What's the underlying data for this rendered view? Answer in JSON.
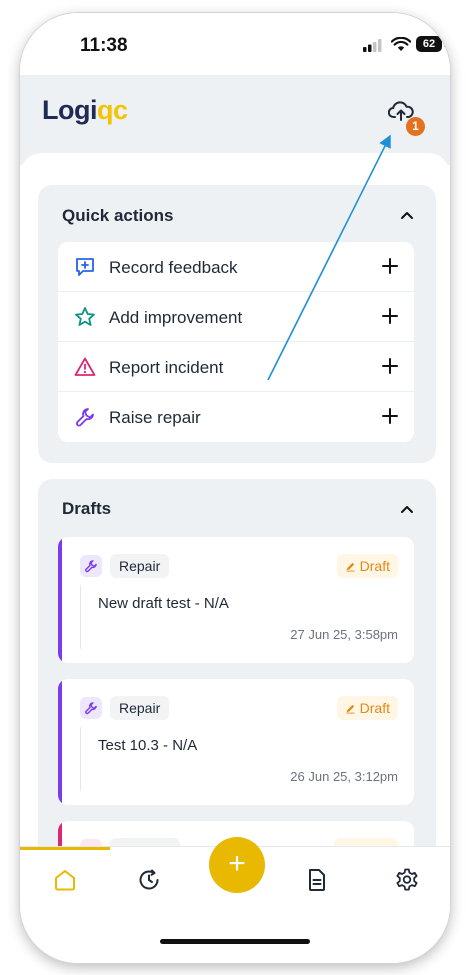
{
  "status_bar": {
    "time": "11:38",
    "battery": "62"
  },
  "header": {
    "logo_part1": "Logi",
    "logo_part2": "qc",
    "upload_badge": "1",
    "accent_color": "#f3c400",
    "brand_color": "#1f2a55"
  },
  "quick_actions": {
    "title": "Quick actions",
    "items": [
      {
        "label": "Record feedback",
        "icon": "feedback-icon"
      },
      {
        "label": "Add improvement",
        "icon": "star-icon"
      },
      {
        "label": "Report incident",
        "icon": "warning-icon"
      },
      {
        "label": "Raise repair",
        "icon": "wrench-icon"
      }
    ]
  },
  "drafts": {
    "title": "Drafts",
    "items": [
      {
        "type": "Repair",
        "status": "Draft",
        "title": "New draft test - N/A",
        "date": "27 Jun 25, 3:58pm"
      },
      {
        "type": "Repair",
        "status": "Draft",
        "title": "Test 10.3 - N/A",
        "date": "26 Jun 25, 3:12pm"
      }
    ]
  },
  "tabbar": {
    "fab_label": "+",
    "tabs": [
      {
        "name": "home-icon",
        "active": true
      },
      {
        "name": "history-icon",
        "active": false
      },
      {
        "name": "document-icon",
        "active": false
      },
      {
        "name": "settings-icon",
        "active": false
      }
    ]
  }
}
